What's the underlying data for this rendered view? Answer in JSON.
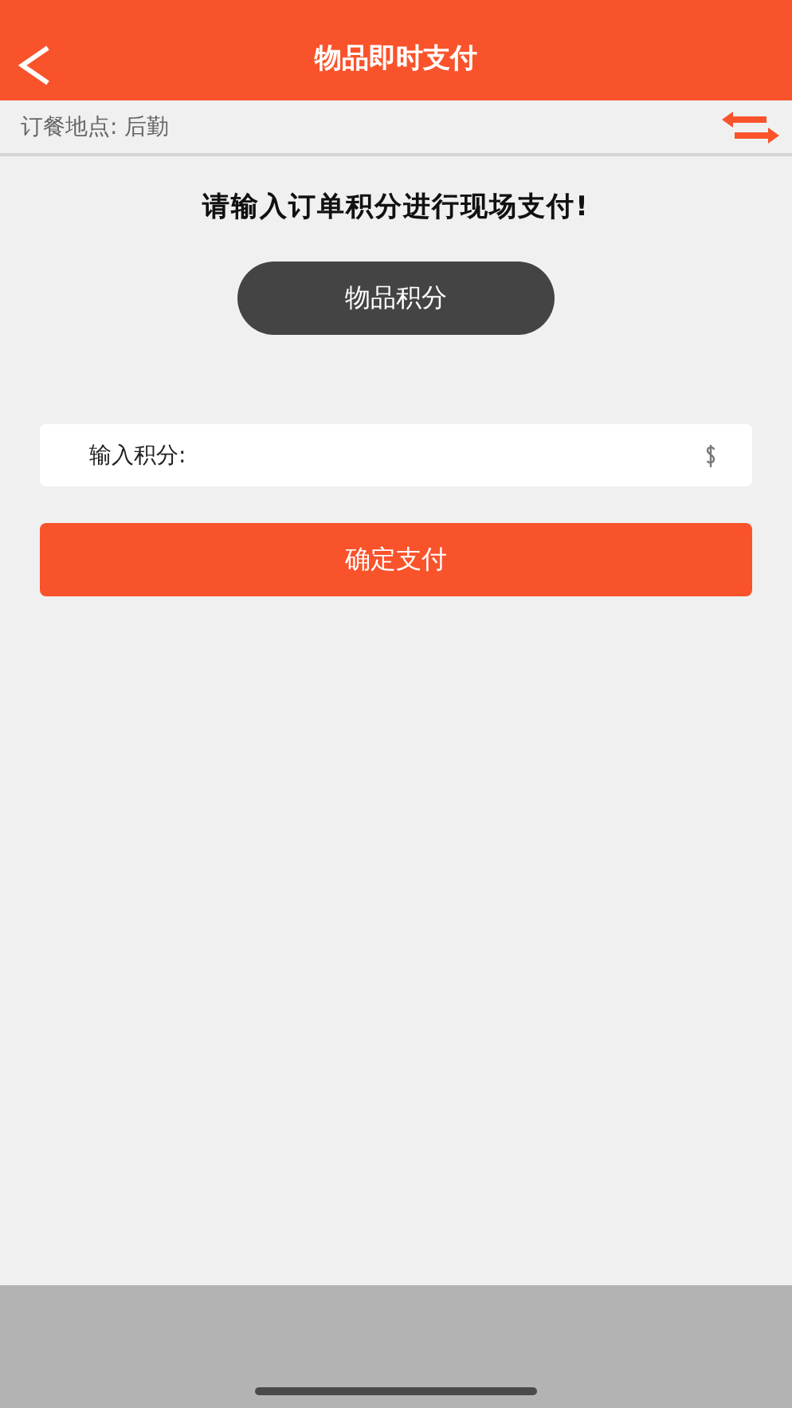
{
  "header": {
    "title": "物品即时支付"
  },
  "location": {
    "label": "订餐地点: 后勤"
  },
  "prompt": "请输入订单积分进行现场支付!",
  "mode_button": "物品积分",
  "points_field": {
    "label": "输入积分:"
  },
  "confirm_button": "确定支付"
}
